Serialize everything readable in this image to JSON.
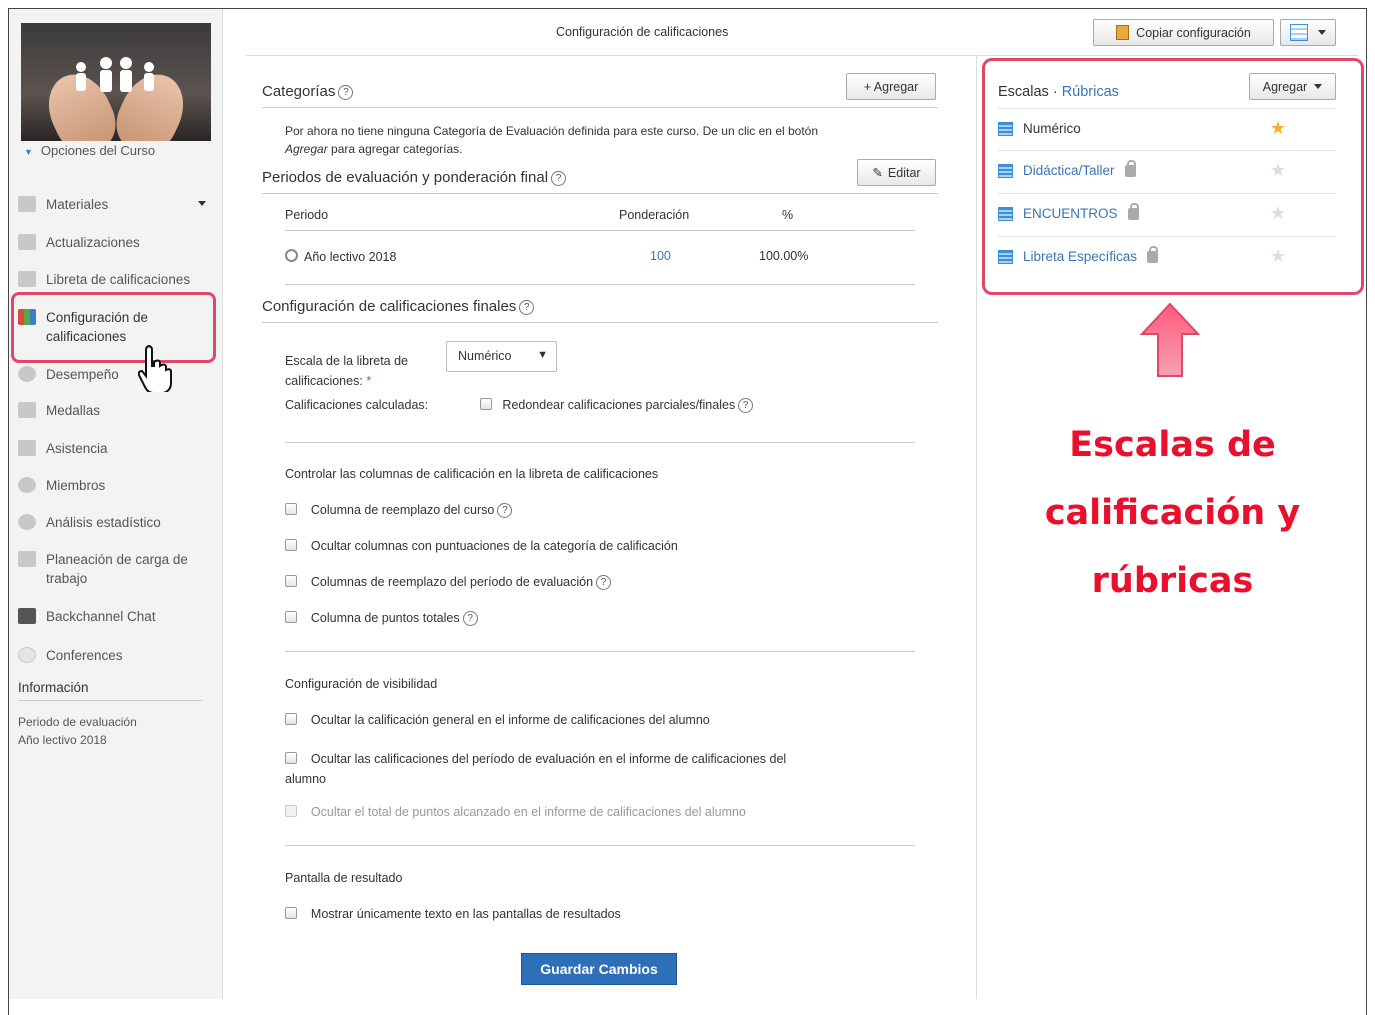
{
  "page_title": "Configuración de calificaciones",
  "toolbar": {
    "copy_label": "Copiar configuración"
  },
  "sidebar": {
    "course_options": "Opciones del Curso",
    "items": [
      {
        "label": "Materiales"
      },
      {
        "label": "Actualizaciones"
      },
      {
        "label": "Libreta de calificaciones"
      },
      {
        "label": "Configuración de calificaciones"
      },
      {
        "label": "Desempeño"
      },
      {
        "label": "Medallas"
      },
      {
        "label": "Asistencia"
      },
      {
        "label": "Miembros"
      },
      {
        "label": "Análisis estadístico"
      },
      {
        "label": "Planeación de carga de trabajo"
      },
      {
        "label": "Backchannel Chat"
      },
      {
        "label": "Conferences"
      }
    ],
    "info_heading": "Información",
    "info_label": "Periodo de evaluación",
    "info_value": "Año lectivo 2018"
  },
  "categories": {
    "title": "Categorías",
    "add_label": "+ Agregar",
    "help_text_1": "Por ahora no tiene ninguna Categoría de Evaluación definida para este curso. De un clic en el botón",
    "help_text_em": "Agregar",
    "help_text_2": "para agregar categorías."
  },
  "periods": {
    "title": "Periodos de evaluación y ponderación final",
    "edit_label": "Editar",
    "columns": [
      "Periodo",
      "Ponderación",
      "%"
    ],
    "rows": [
      {
        "period": "Año lectivo 2018",
        "weight": "100",
        "percent": "100.00%"
      }
    ]
  },
  "final_config": {
    "title": "Configuración de calificaciones finales",
    "scale_label_1": "Escala de la libreta de",
    "scale_label_2": "calificaciones:",
    "required_mark": "*",
    "scale_value": "Numérico",
    "calculated_label": "Calificaciones calculadas:",
    "round_label": "Redondear calificaciones parciales/finales",
    "columns_heading": "Controlar las columnas de calificación en la libreta de calificaciones",
    "column_options": [
      "Columna de reemplazo del curso",
      "Ocultar columnas con puntuaciones de la categoría de calificación",
      "Columnas de reemplazo del período de evaluación",
      "Columna de puntos totales"
    ],
    "visibility_heading": "Configuración de visibilidad",
    "visibility_options": [
      "Ocultar la calificación general en el informe de calificaciones del alumno",
      "Ocultar las calificaciones del período de evaluación en el informe de calificaciones del",
      "alumno",
      "Ocultar el total de puntos alcanzado en el informe de calificaciones del alumno"
    ],
    "results_heading": "Pantalla de resultado",
    "results_option": "Mostrar únicamente texto en las pantallas de resultados",
    "save_label": "Guardar Cambios"
  },
  "scales": {
    "title": "Escalas",
    "separator": "·",
    "rubrics_link": "Rúbricas",
    "add_label": "Agregar",
    "items": [
      {
        "name": "Numérico",
        "default": true,
        "locked": false
      },
      {
        "name": "Didáctica/Taller",
        "default": false,
        "locked": true
      },
      {
        "name": "ENCUENTROS",
        "default": false,
        "locked": true
      },
      {
        "name": "Libreta Específicas",
        "default": false,
        "locked": true
      }
    ]
  },
  "annotation": {
    "line1": "Escalas de",
    "line2": "calificación y",
    "line3": "rúbricas",
    "color": "#e8102c"
  },
  "colors": {
    "accent": "#3a74b5",
    "highlight": "#e0486a",
    "save_button": "#2e6fb8"
  }
}
